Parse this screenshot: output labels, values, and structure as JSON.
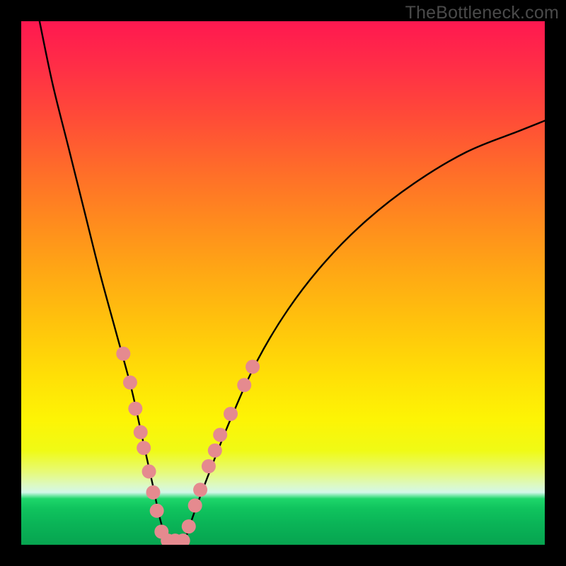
{
  "watermark": "TheBottleneck.com",
  "icons": {},
  "chart_data": {
    "type": "line",
    "title": "",
    "xlabel": "",
    "ylabel": "",
    "xlim": [
      0,
      100
    ],
    "ylim": [
      0,
      100
    ],
    "grid": false,
    "legend": false,
    "series": [
      {
        "name": "left-branch",
        "x": [
          3.5,
          6,
          9,
          12,
          15,
          18,
          21,
          23,
          25,
          26.5,
          28
        ],
        "y": [
          100,
          88,
          76,
          64,
          52,
          41,
          30,
          21,
          12,
          5,
          0
        ]
      },
      {
        "name": "right-branch",
        "x": [
          31,
          33,
          36,
          40,
          45,
          51,
          58,
          66,
          75,
          85,
          95,
          100
        ],
        "y": [
          0,
          6,
          14,
          24,
          35,
          45,
          54,
          62,
          69,
          75,
          79,
          81
        ]
      }
    ],
    "scatter": {
      "name": "data-beads",
      "points": [
        {
          "x": 19.5,
          "y": 36.5
        },
        {
          "x": 20.8,
          "y": 31.0
        },
        {
          "x": 21.8,
          "y": 26.0
        },
        {
          "x": 22.8,
          "y": 21.5
        },
        {
          "x": 23.4,
          "y": 18.5
        },
        {
          "x": 24.4,
          "y": 14.0
        },
        {
          "x": 25.2,
          "y": 10.0
        },
        {
          "x": 25.9,
          "y": 6.5
        },
        {
          "x": 26.8,
          "y": 2.5
        },
        {
          "x": 28.0,
          "y": 0.8
        },
        {
          "x": 29.4,
          "y": 0.8
        },
        {
          "x": 30.9,
          "y": 0.8
        },
        {
          "x": 32.0,
          "y": 3.5
        },
        {
          "x": 33.2,
          "y": 7.5
        },
        {
          "x": 34.2,
          "y": 10.5
        },
        {
          "x": 35.8,
          "y": 15.0
        },
        {
          "x": 37.0,
          "y": 18.0
        },
        {
          "x": 38.0,
          "y": 21.0
        },
        {
          "x": 40.0,
          "y": 25.0
        },
        {
          "x": 42.6,
          "y": 30.5
        },
        {
          "x": 44.2,
          "y": 34.0
        }
      ]
    },
    "gradient_bands": [
      {
        "label": "red-top",
        "approx_y_pct_range": [
          0,
          40
        ]
      },
      {
        "label": "orange-mid",
        "approx_y_pct_range": [
          40,
          65
        ]
      },
      {
        "label": "yellow-band",
        "approx_y_pct_range": [
          65,
          88
        ]
      },
      {
        "label": "pale-band",
        "approx_y_pct_range": [
          88,
          91
        ]
      },
      {
        "label": "green-bottom",
        "approx_y_pct_range": [
          91,
          100
        ]
      }
    ]
  }
}
